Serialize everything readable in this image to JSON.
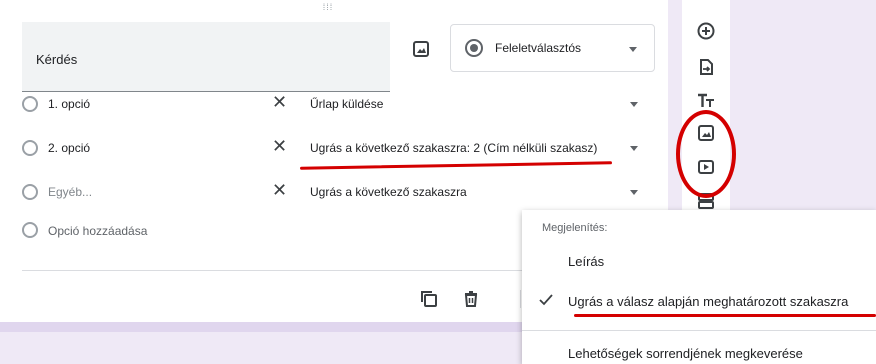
{
  "question": {
    "placeholder": "Kérdés"
  },
  "type_select": {
    "label": "Feleletválasztós"
  },
  "options": [
    {
      "label": "1. opció",
      "action": "Űrlap küldése"
    },
    {
      "label": "2. opció",
      "action": "Ugrás a következő szakaszra: 2 (Cím nélküli szakasz)"
    },
    {
      "label": "Egyéb...",
      "action": "Ugrás a következő szakaszra"
    }
  ],
  "add_option": {
    "label": "Opció hozzáadása"
  },
  "menu": {
    "header": "Megjelenítés:",
    "items": [
      {
        "label": "Leírás",
        "checked": false
      },
      {
        "label": "Ugrás a válasz alapján meghatározott szakaszra",
        "checked": true
      },
      {
        "label": "Lehetőségek sorrendjének megkeverése",
        "checked": false
      }
    ]
  },
  "toolbar_icons": [
    "add-question-icon",
    "import-questions-icon",
    "add-title-icon",
    "add-image-icon",
    "add-video-icon",
    "add-section-icon"
  ],
  "footer_icons": [
    "duplicate-icon",
    "delete-icon"
  ],
  "colors": {
    "annotation_red": "#d40000",
    "theme_background": "#efe9f6"
  }
}
